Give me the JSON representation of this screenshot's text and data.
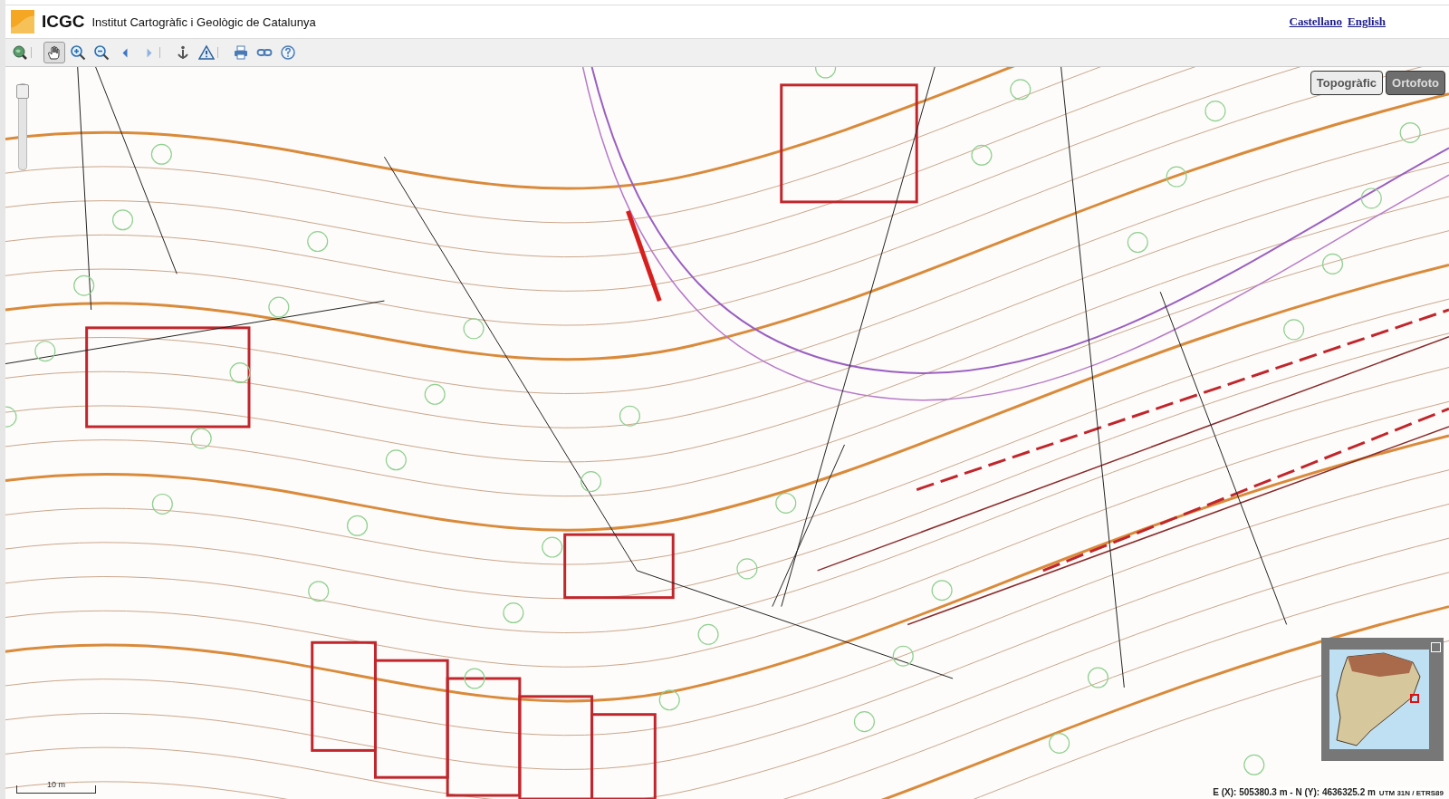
{
  "header": {
    "logo_text": "ICGC",
    "title": "Institut Cartogràfic i Geològic de Catalunya",
    "languages": [
      {
        "label": "Castellano"
      },
      {
        "label": "English"
      }
    ]
  },
  "toolbar": {
    "tools": [
      {
        "kind": "overview",
        "selected": false,
        "group_end": true
      },
      {
        "kind": "pan",
        "selected": true,
        "group_end": false
      },
      {
        "kind": "zoom_in",
        "selected": false,
        "group_end": false
      },
      {
        "kind": "zoom_out",
        "selected": false,
        "group_end": false
      },
      {
        "kind": "back",
        "selected": false,
        "group_end": false
      },
      {
        "kind": "forward",
        "selected": false,
        "group_end": true
      },
      {
        "kind": "info",
        "selected": false,
        "group_end": false
      },
      {
        "kind": "warning",
        "selected": false,
        "group_end": true
      },
      {
        "kind": "print",
        "selected": false,
        "group_end": false
      },
      {
        "kind": "link",
        "selected": false,
        "group_end": false
      },
      {
        "kind": "help",
        "selected": false,
        "group_end": false
      }
    ]
  },
  "map": {
    "zoom_slider": {
      "level": 1
    },
    "basemaps": [
      {
        "label": "Topogràfic",
        "selected": false
      },
      {
        "label": "Ortofoto",
        "selected": true
      }
    ],
    "overview_map": {
      "expanded": true
    },
    "scale_bar": {
      "label": "10 m"
    },
    "coordinates": {
      "text": "E (X): 505380.3 m - N (Y): 4636325.2 m",
      "crs": "UTM 31N / ETRS89"
    }
  }
}
